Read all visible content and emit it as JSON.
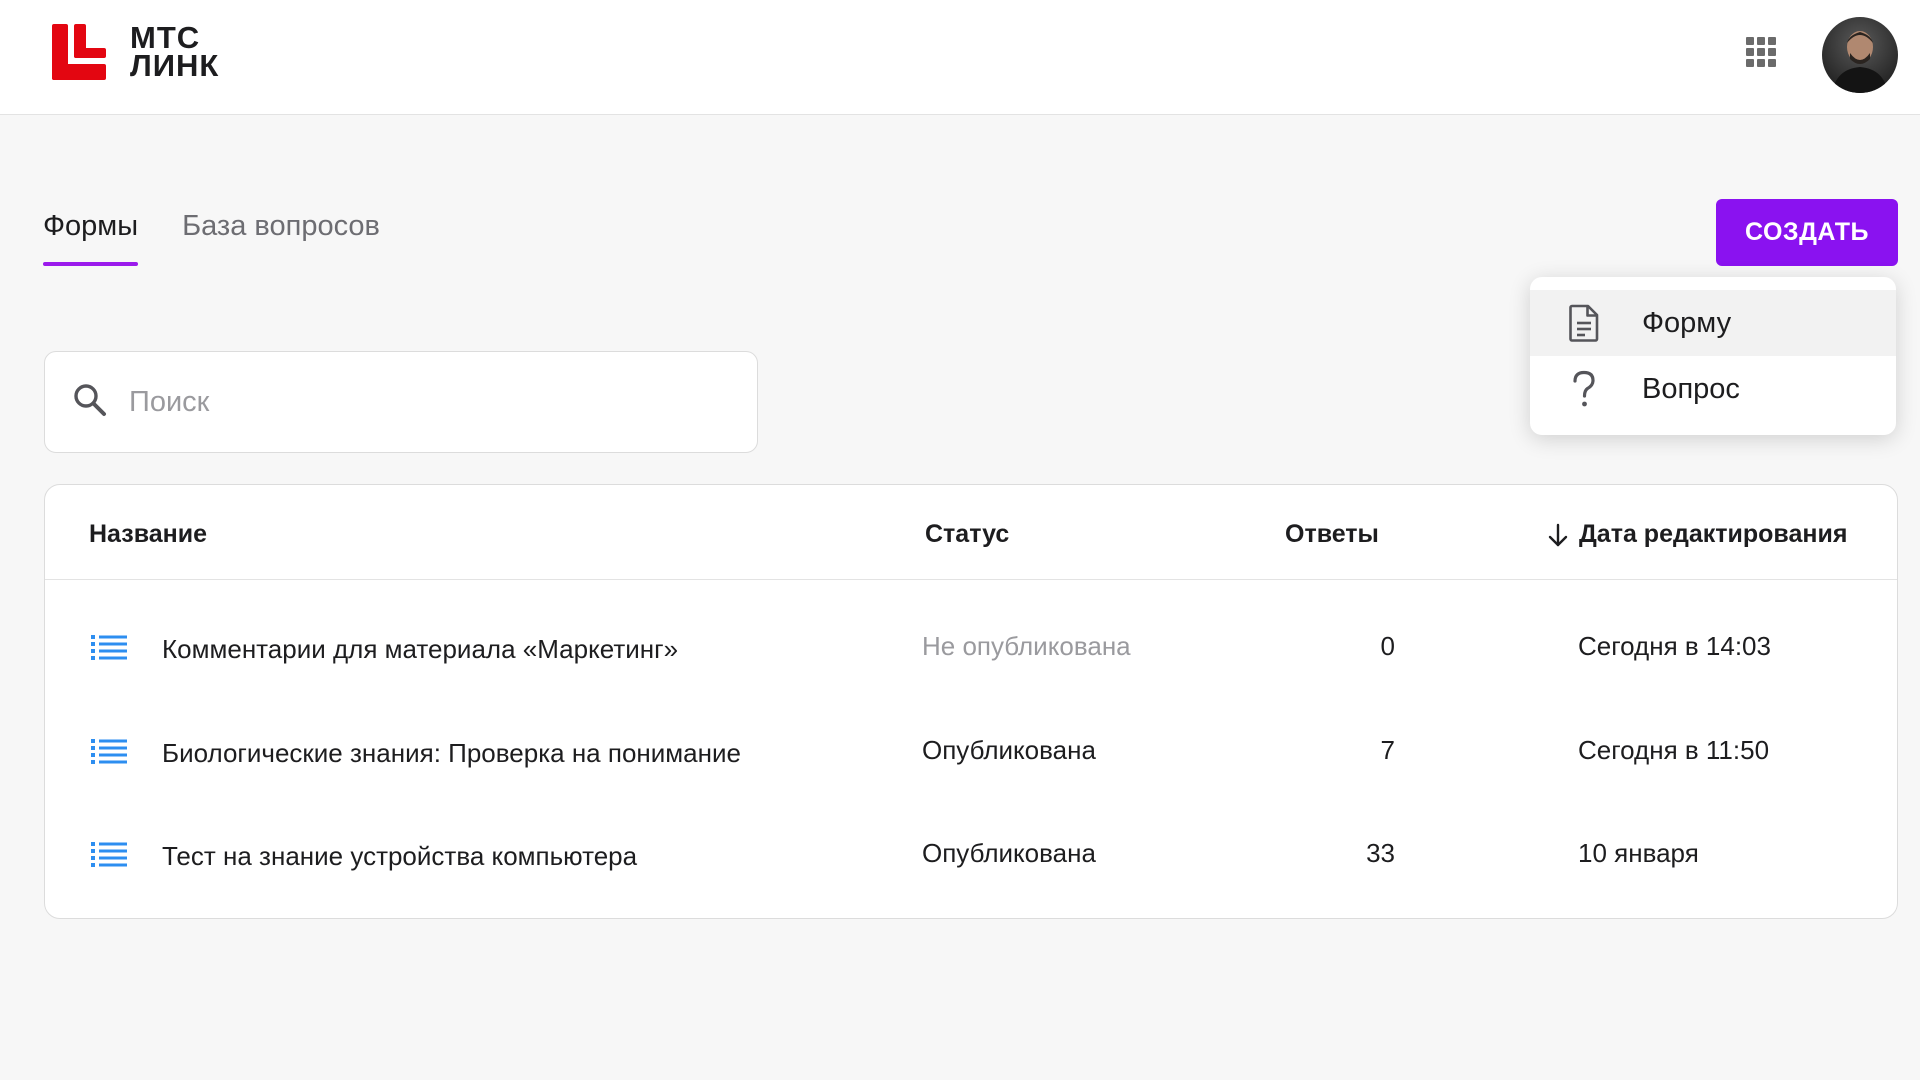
{
  "header": {
    "logo": {
      "line1": "МТС",
      "line2": "ЛИНК",
      "color": "#e30611"
    },
    "apps_icon": "apps-grid-icon",
    "avatar_icon": "user-avatar"
  },
  "tabs": [
    {
      "label": "Формы",
      "active": true
    },
    {
      "label": "База вопросов",
      "active": false
    }
  ],
  "create_button": {
    "label": "СОЗДАТЬ",
    "color": "#8a12f0"
  },
  "create_menu": {
    "items": [
      {
        "label": "Форму",
        "icon": "document-icon",
        "highlighted": true
      },
      {
        "label": "Вопрос",
        "icon": "question-icon",
        "highlighted": false
      }
    ]
  },
  "search": {
    "placeholder": "Поиск",
    "value": ""
  },
  "table": {
    "columns": {
      "name": "Название",
      "status": "Статус",
      "answers": "Ответы",
      "date": "Дата редактирования"
    },
    "sort": {
      "column": "date",
      "direction": "desc"
    },
    "rows": [
      {
        "name": "Комментарии для материала «Маркетинг»",
        "status": "Не опубликована",
        "published": false,
        "answers": "0",
        "date": "Сегодня в 14:03"
      },
      {
        "name": "Биологические знания: Проверка на понимание",
        "status": "Опубликована",
        "published": true,
        "answers": "7",
        "date": "Сегодня в 11:50"
      },
      {
        "name": "Тест на знание устройства компьютера",
        "status": "Опубликована",
        "published": true,
        "answers": "33",
        "date": "10 января"
      }
    ]
  },
  "colors": {
    "accent": "#9b1aec",
    "list_icon": "#2d8ef0",
    "muted_text": "#9a9a9e"
  }
}
